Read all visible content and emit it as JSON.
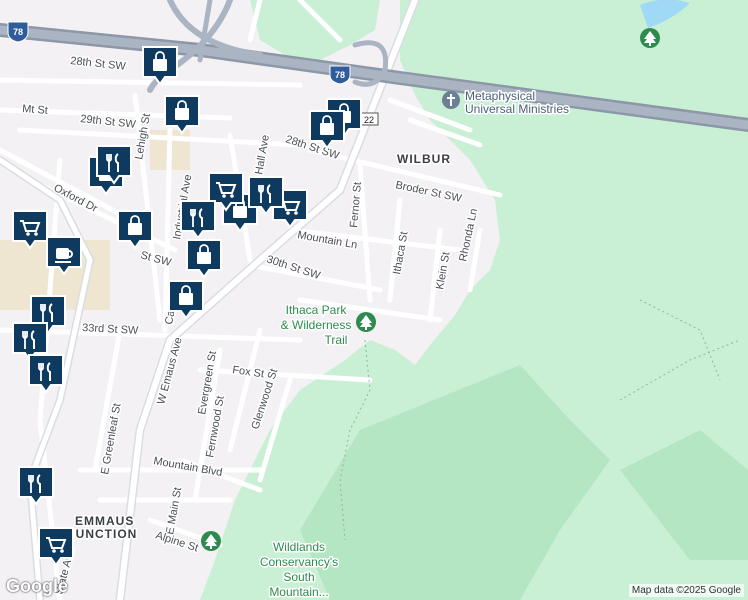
{
  "map": {
    "attribution": "Map data ©2025 Google",
    "logo": "Google",
    "colors": {
      "background": "#f3f1f4",
      "park": "#c9efd5",
      "park_dark": "#b5e6c4",
      "highway": "#9aa7b8",
      "road": "#ffffff",
      "marker": "#0e3a5f",
      "park_icon": "#2e8b4f",
      "commercial": "#efe6d2"
    },
    "shields": {
      "interstate": "78",
      "route": "22"
    },
    "area_labels": {
      "wilbur": "WILBUR",
      "emmaus_junction_1": "EMMAUS",
      "emmaus_junction_2": "JUNCTION"
    },
    "streets": {
      "s28_a": "28th St SW",
      "s29": "29th St SW",
      "s28_b": "28th St SW",
      "mt": "Mt St",
      "oxford": "Oxford Dr",
      "lehigh": "Lehigh St",
      "industrial": "Industrial Ave",
      "hall": "Hall Ave",
      "broder": "Broder St SW",
      "fernor": "Fernor St",
      "mountain_ln": "Mountain Ln",
      "s30": "30th St SW",
      "ithaca": "Ithaca St",
      "klein": "Klein St",
      "rhonda": "Rhonda Ln",
      "s33": "33rd St SW",
      "w_emaus": "W Emaus Ave",
      "evergreen": "Evergreen St",
      "fox": "Fox St",
      "fernwood": "Fernwood St",
      "glenwood": "Glenwood St",
      "e_greenleaf": "E Greenleaf St",
      "mountain_blvd": "Mountain Blvd",
      "e_main": "E Main St",
      "alpine": "Alpine St",
      "state": "State Ave",
      "st_sw": "St SW",
      "ca": "Ca"
    },
    "pois": {
      "metaphysical_1": "Metaphysical",
      "metaphysical_2": "Universal Ministries",
      "ithaca_park_1": "Ithaca Park",
      "ithaca_park_2": "& Wilderness",
      "ithaca_park_3": "Trail",
      "wildlands_1": "Wildlands",
      "wildlands_2": "Conservancy's",
      "wildlands_3": "South",
      "wildlands_4": "Mountain..."
    },
    "markers": [
      {
        "type": "shopping",
        "icon": "shopping-bag-icon"
      },
      {
        "type": "shopping",
        "icon": "shopping-bag-icon"
      },
      {
        "type": "shopping",
        "icon": "shopping-bag-icon"
      },
      {
        "type": "shopping",
        "icon": "shopping-bag-icon"
      },
      {
        "type": "shopping",
        "icon": "shopping-bag-icon"
      },
      {
        "type": "shopping",
        "icon": "shopping-bag-icon"
      },
      {
        "type": "shopping",
        "icon": "shopping-bag-icon"
      },
      {
        "type": "shopping",
        "icon": "shopping-bag-icon"
      },
      {
        "type": "shopping",
        "icon": "shopping-bag-icon"
      },
      {
        "type": "grocery",
        "icon": "shopping-cart-icon"
      },
      {
        "type": "grocery",
        "icon": "shopping-cart-icon"
      },
      {
        "type": "grocery",
        "icon": "shopping-cart-icon"
      },
      {
        "type": "grocery",
        "icon": "shopping-cart-icon"
      },
      {
        "type": "restaurant",
        "icon": "fork-knife-icon"
      },
      {
        "type": "restaurant",
        "icon": "fork-knife-icon"
      },
      {
        "type": "restaurant",
        "icon": "fork-knife-icon"
      },
      {
        "type": "restaurant",
        "icon": "fork-knife-icon"
      },
      {
        "type": "restaurant",
        "icon": "fork-knife-icon"
      },
      {
        "type": "restaurant",
        "icon": "fork-knife-icon"
      },
      {
        "type": "restaurant",
        "icon": "fork-knife-icon"
      },
      {
        "type": "cafe",
        "icon": "coffee-cup-icon"
      }
    ]
  }
}
